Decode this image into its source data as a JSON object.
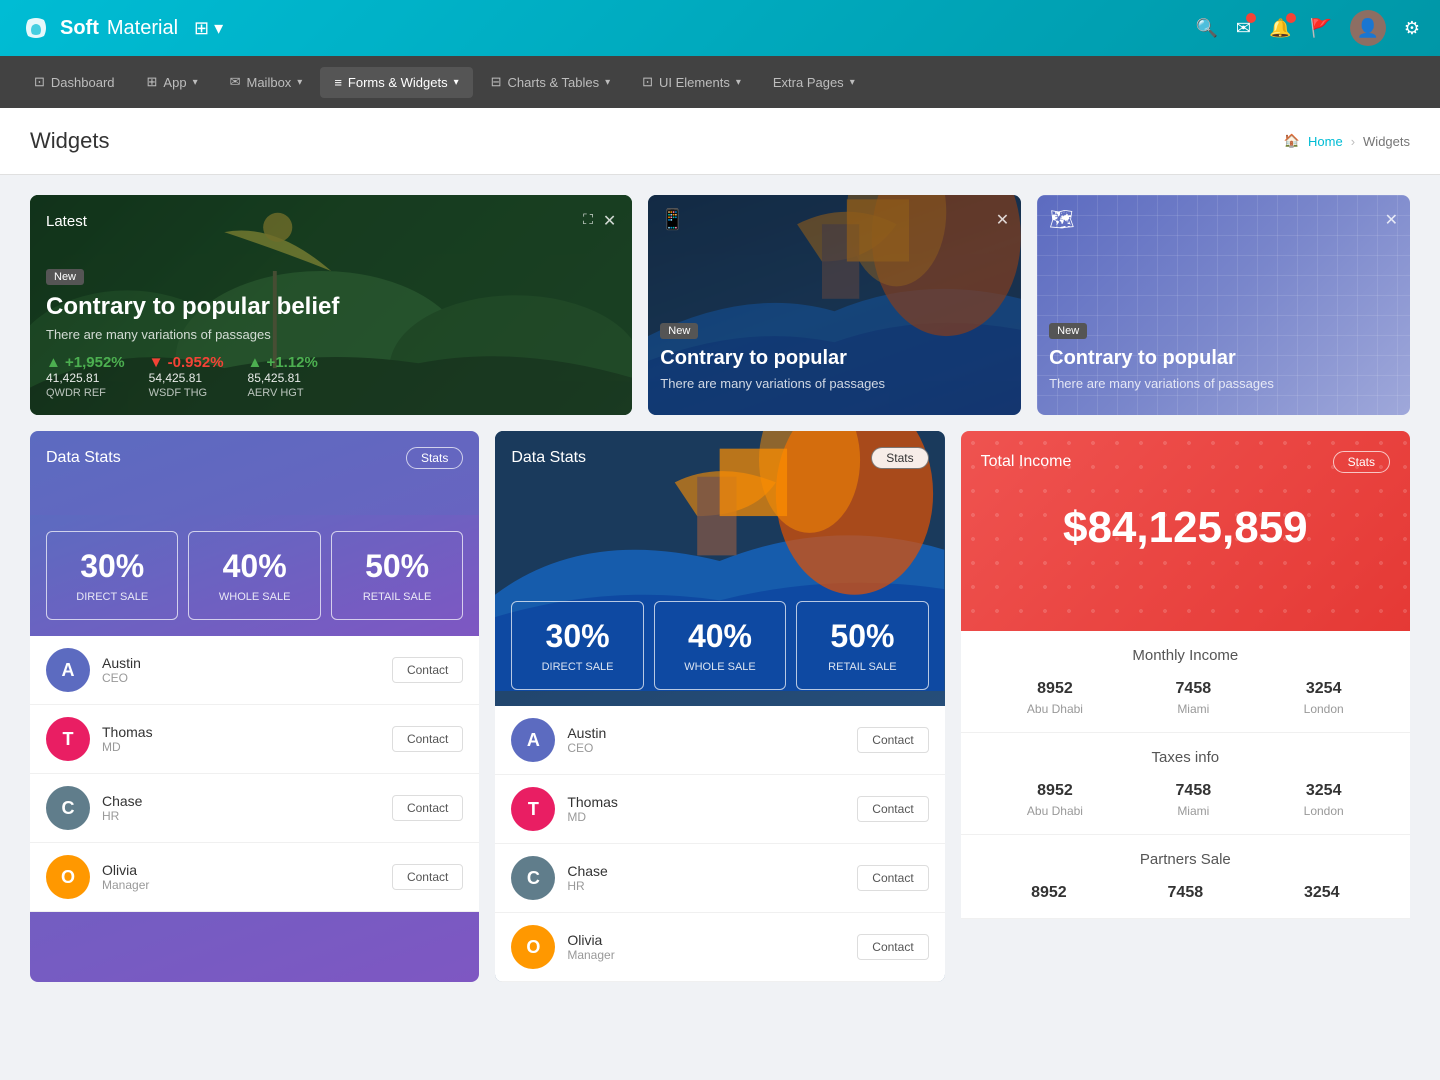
{
  "topnav": {
    "brand": "Soft",
    "brand2": "Material",
    "app_icon": "⊞"
  },
  "secondnav": {
    "items": [
      {
        "label": "Dashboard",
        "icon": "⊡",
        "active": false
      },
      {
        "label": "App",
        "icon": "⊞",
        "active": false,
        "caret": true
      },
      {
        "label": "Mailbox",
        "icon": "✉",
        "active": false,
        "caret": true
      },
      {
        "label": "Forms & Widgets",
        "icon": "≡",
        "active": true,
        "caret": true
      },
      {
        "label": "Charts & Tables",
        "icon": "⊟",
        "active": false,
        "caret": true
      },
      {
        "label": "UI Elements",
        "icon": "⊡",
        "active": false,
        "caret": true
      },
      {
        "label": "Extra Pages",
        "icon": "",
        "active": false,
        "caret": true
      }
    ]
  },
  "breadcrumb": {
    "page_title": "Widgets",
    "home": "Home",
    "current": "Widgets"
  },
  "card_latest": {
    "label": "Latest",
    "badge": "New",
    "title": "Contrary to popular belief",
    "subtitle": "There are many variations of passages",
    "stats": [
      {
        "value": "+1,952%",
        "amount": "41,425.81",
        "ref": "QWDR REF",
        "type": "up"
      },
      {
        "value": "-0.952%",
        "amount": "54,425.81",
        "ref": "WSDF THG",
        "type": "down"
      },
      {
        "value": "+1.12%",
        "amount": "85,425.81",
        "ref": "AERV HGT",
        "type": "up"
      }
    ]
  },
  "card_medium": {
    "badge": "New",
    "title": "Contrary to popular",
    "subtitle": "There are many variations of passages"
  },
  "card_purple": {
    "badge": "New",
    "title": "Contrary to popular",
    "subtitle": "There are many variations of passages"
  },
  "data_stats_1": {
    "title": "Data Stats",
    "btn": "Stats",
    "percentages": [
      {
        "value": "30%",
        "label": "DIRECT SALE"
      },
      {
        "value": "40%",
        "label": "WHOLE SALE"
      },
      {
        "value": "50%",
        "label": "RETAIL SALE"
      }
    ],
    "contacts": [
      {
        "name": "Austin",
        "role": "CEO",
        "btn": "Contact",
        "color": "#5c6bc0"
      },
      {
        "name": "Thomas",
        "role": "MD",
        "btn": "Contact",
        "color": "#e91e63"
      },
      {
        "name": "Chase",
        "role": "HR",
        "btn": "Contact",
        "color": "#607d8b"
      },
      {
        "name": "Olivia",
        "role": "Manager",
        "btn": "Contact",
        "color": "#ff9800"
      }
    ]
  },
  "data_stats_2": {
    "title": "Data Stats",
    "btn": "Stats",
    "percentages": [
      {
        "value": "30%",
        "label": "DIRECT SALE"
      },
      {
        "value": "40%",
        "label": "WHOLE SALE"
      },
      {
        "value": "50%",
        "label": "RETAIL SALE"
      }
    ],
    "contacts": [
      {
        "name": "Austin",
        "role": "CEO",
        "btn": "Contact",
        "color": "#5c6bc0"
      },
      {
        "name": "Thomas",
        "role": "MD",
        "btn": "Contact",
        "color": "#e91e63"
      },
      {
        "name": "Chase",
        "role": "HR",
        "btn": "Contact",
        "color": "#607d8b"
      },
      {
        "name": "Olivia",
        "role": "Manager",
        "btn": "Contact",
        "color": "#ff9800"
      }
    ]
  },
  "total_income": {
    "title": "Total Income",
    "btn": "Stats",
    "amount": "$84,125,859",
    "monthly": {
      "title": "Monthly Income",
      "stats": [
        {
          "num": "8952",
          "city": "Abu Dhabi"
        },
        {
          "num": "7458",
          "city": "Miami"
        },
        {
          "num": "3254",
          "city": "London"
        }
      ]
    },
    "taxes": {
      "title": "Taxes info",
      "stats": [
        {
          "num": "8952",
          "city": "Abu Dhabi"
        },
        {
          "num": "7458",
          "city": "Miami"
        },
        {
          "num": "3254",
          "city": "London"
        }
      ]
    },
    "partners": {
      "title": "Partners Sale",
      "stats": [
        {
          "num": "8952",
          "city": ""
        },
        {
          "num": "7458",
          "city": ""
        },
        {
          "num": "3254",
          "city": ""
        }
      ]
    }
  }
}
